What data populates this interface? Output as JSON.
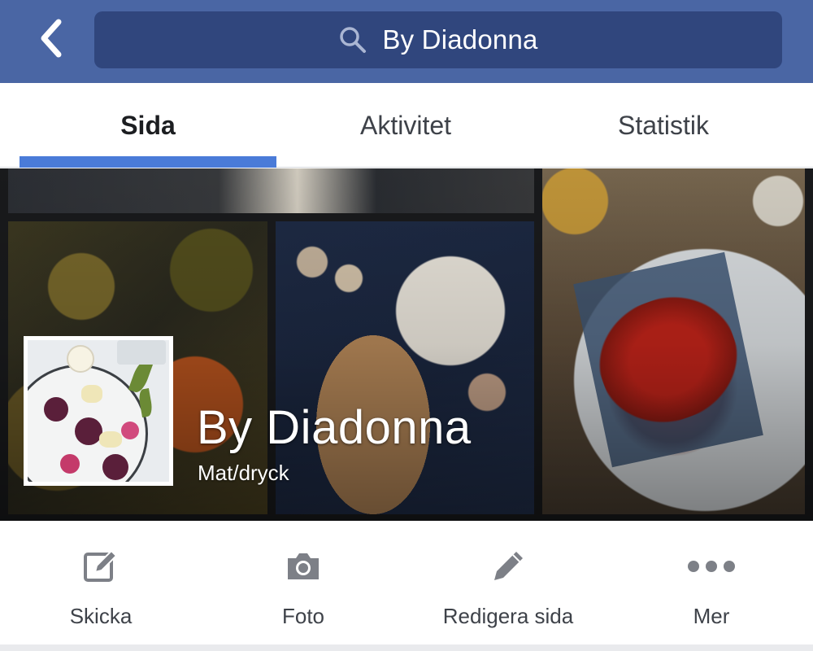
{
  "header": {
    "back_icon": "chevron-left-icon",
    "search_icon": "search-icon",
    "search_text": "By Diadonna"
  },
  "tabs": [
    {
      "label": "Sida",
      "active": true
    },
    {
      "label": "Aktivitet",
      "active": false
    },
    {
      "label": "Statistik",
      "active": false
    }
  ],
  "profile": {
    "name": "By Diadonna",
    "category": "Mat/dryck"
  },
  "actions": [
    {
      "label": "Skicka",
      "icon": "compose-icon"
    },
    {
      "label": "Foto",
      "icon": "camera-icon"
    },
    {
      "label": "Redigera sida",
      "icon": "pencil-icon"
    },
    {
      "label": "Mer",
      "icon": "more-icon"
    }
  ],
  "colors": {
    "header_bg": "#4a66a4",
    "search_bg": "#30467d",
    "tab_indicator": "#4a7bd8",
    "icon_gray": "#7d8087"
  }
}
